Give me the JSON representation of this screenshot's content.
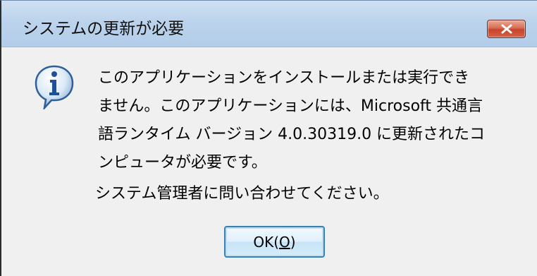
{
  "window": {
    "title": "システムの更新が必要",
    "close_label": "×"
  },
  "message": {
    "lines": [
      "このアプリケーションをインストールまたは実行でき",
      "ません。このアプリケーションには、Microsoft 共通言",
      "語ランタイム バージョン 4.0.30319.0 に更新されたコ",
      "ンピュータが必要です。"
    ],
    "contact": "システム管理者に問い合わせてください。"
  },
  "buttons": {
    "ok_prefix": "OK(",
    "ok_accel": "O",
    "ok_suffix": ")"
  },
  "icons": {
    "info": "info-icon",
    "close": "close-icon"
  },
  "colors": {
    "titlebar": "#bcd3ec",
    "close_button": "#c7442b",
    "body": "#f0f0f0",
    "ok_border": "#3c7fb1"
  }
}
